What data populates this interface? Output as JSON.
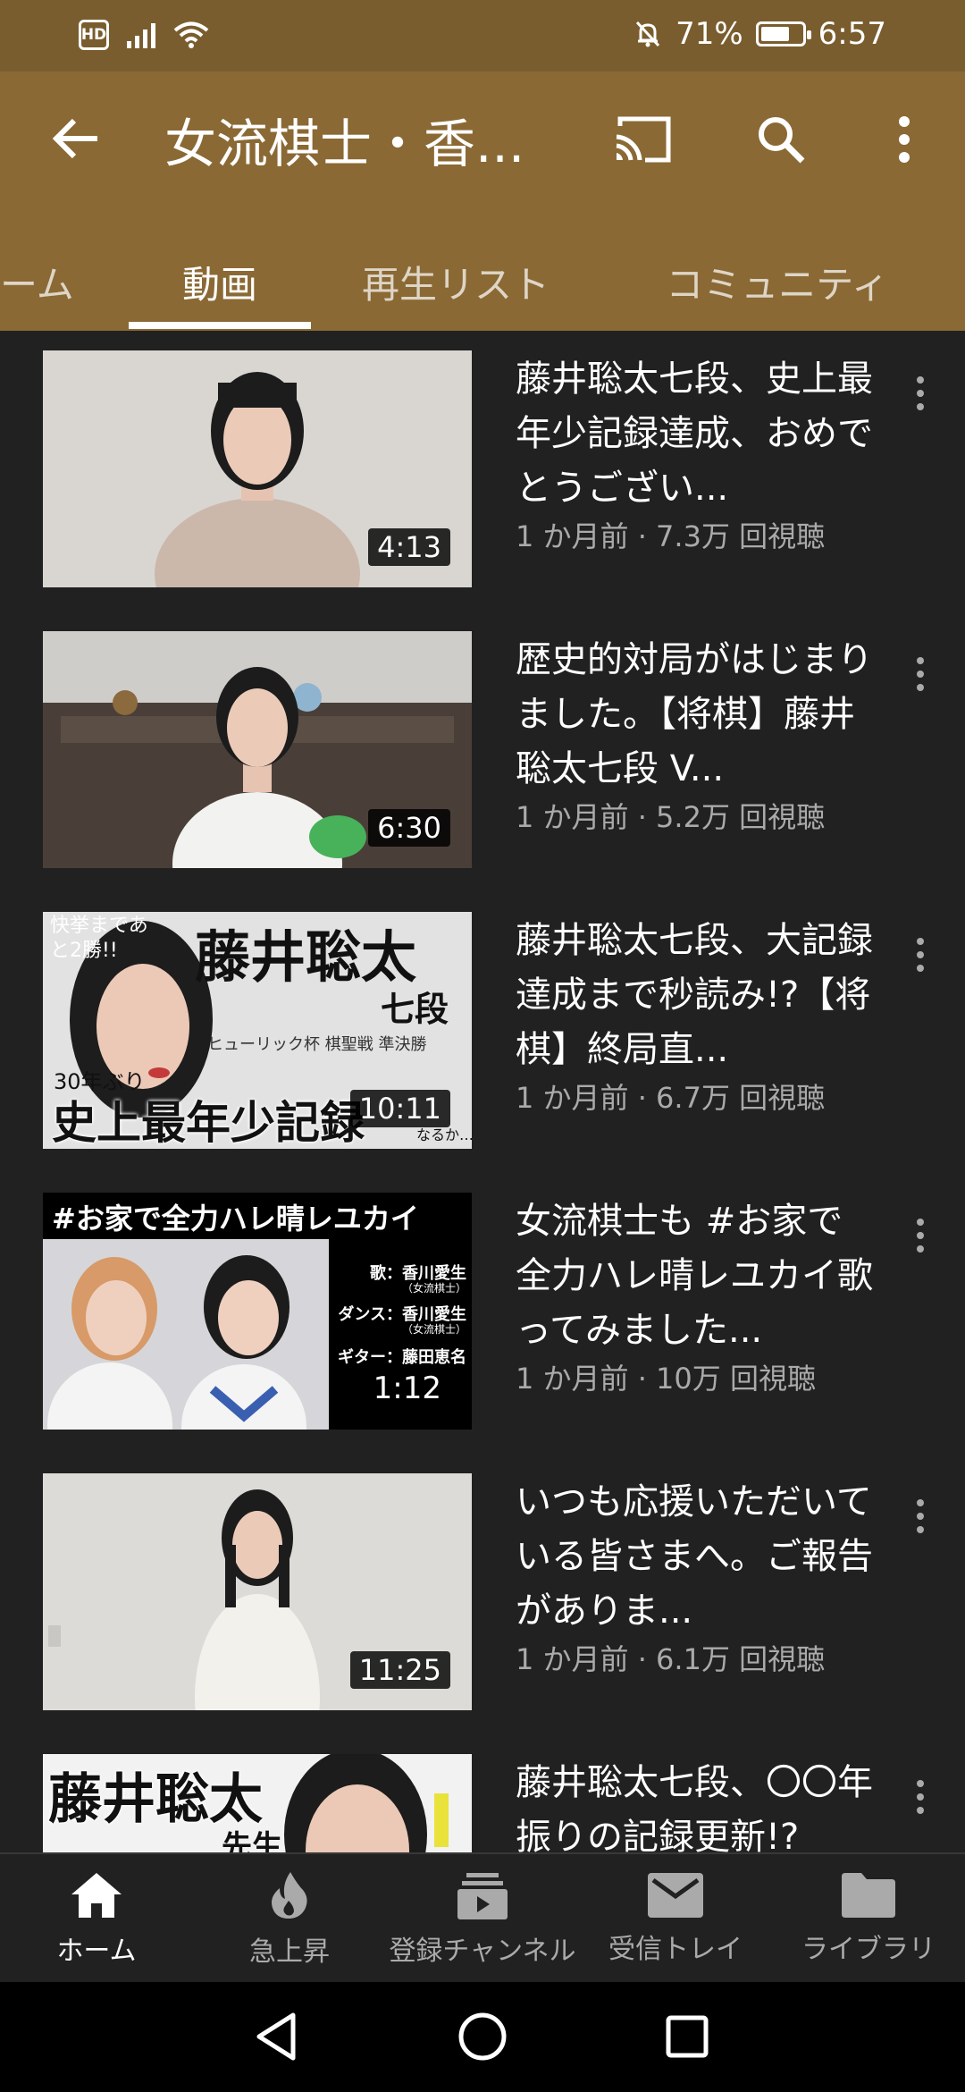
{
  "status_bar": {
    "hd": "HD",
    "battery_percent": "71%",
    "battery_level": 0.71,
    "time": "6:57"
  },
  "app_bar": {
    "title": "女流棋士・香..."
  },
  "tabs": [
    {
      "label": "ーム"
    },
    {
      "label": "動画",
      "active": true
    },
    {
      "label": "再生リスト"
    },
    {
      "label": "コミュニティ"
    }
  ],
  "videos": [
    {
      "title": "藤井聡太七段、史上最年少記録達成、おめでとうござい...",
      "meta": "1 か月前 · 7.3万 回視聴",
      "duration": "4:13"
    },
    {
      "title": "歴史的対局がはじまりました。【将棋】藤井聡太七段 V...",
      "meta": "1 か月前 · 5.2万 回視聴",
      "duration": "6:30"
    },
    {
      "title": "藤井聡太七段、大記録達成まで秒読み!?【将棋】終局直...",
      "meta": "1 か月前 · 6.7万 回視聴",
      "duration": "10:11",
      "thumb_text": {
        "badge": "快挙まであと2勝!!",
        "name": "藤井聡太",
        "rank": "七段",
        "event": "ヒューリック杯 棋聖戦 準決勝",
        "years": "30年ぶり",
        "headline": "史上最年少記録",
        "suffix": "なるか…!?"
      }
    },
    {
      "title": "女流棋士も #お家で全力ハレ晴レユカイ歌ってみました...",
      "meta": "1 か月前 · 10万 回視聴",
      "duration": "1:12",
      "thumb_text": {
        "banner": "#お家で全力ハレ晴レユカイ",
        "credit1": "歌：香川愛生",
        "credit1_sub": "（女流棋士）",
        "credit2": "ダンス：香川愛生",
        "credit2_sub": "（女流棋士）",
        "credit3": "ギター：藤田恵名"
      }
    },
    {
      "title": "いつも応援いただいている皆さまへ。ご報告がありま...",
      "meta": "1 か月前 · 6.1万 回視聴",
      "duration": "11:25"
    },
    {
      "title": "藤井聡太七段、〇〇年振りの記録更新!?",
      "meta": "",
      "thumb_text": {
        "name": "藤井聡太",
        "honorific": "先生"
      }
    }
  ],
  "bottom_nav": [
    {
      "label": "ホーム",
      "icon": "home-icon",
      "active": true
    },
    {
      "label": "急上昇",
      "icon": "flame-icon"
    },
    {
      "label": "登録チャンネル",
      "icon": "subscriptions-icon"
    },
    {
      "label": "受信トレイ",
      "icon": "mail-icon"
    },
    {
      "label": "ライブラリ",
      "icon": "folder-icon"
    }
  ],
  "colors": {
    "header": "#8a6934",
    "status_bar": "#7a5d2e",
    "background": "#212121",
    "meta_text": "#aaaaaa"
  }
}
